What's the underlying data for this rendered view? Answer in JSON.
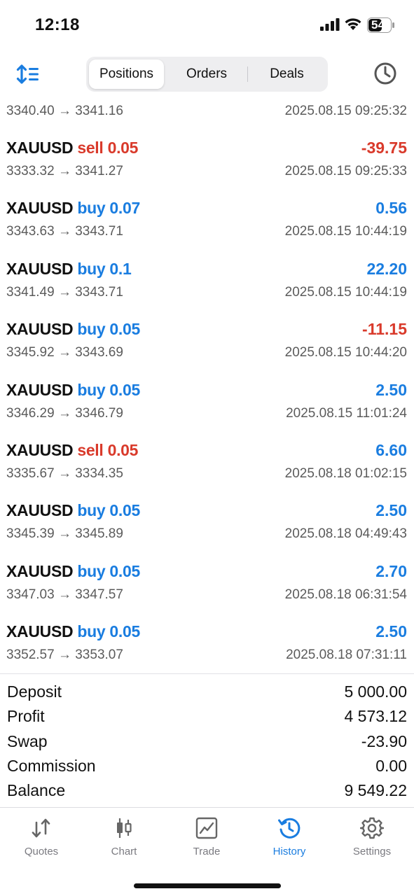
{
  "status_bar": {
    "time": "12:18",
    "battery": "54"
  },
  "toolbar": {
    "tabs": [
      {
        "label": "Positions",
        "active": true
      },
      {
        "label": "Orders",
        "active": false
      },
      {
        "label": "Deals",
        "active": false
      }
    ],
    "left_icon": "sort-icon",
    "right_icon": "clock-icon"
  },
  "colors": {
    "buy": "#1a7de0",
    "sell": "#d93a2b",
    "accent": "#1a7de0"
  },
  "partial_row": {
    "prices": "3340.40 → 3341.16",
    "date": "2025.08.15 09:25:32"
  },
  "trades": [
    {
      "symbol": "XAUUSD",
      "direction": "sell 0.05",
      "type": "sell",
      "profit": "-39.75",
      "profit_sign": "neg",
      "prices": "3333.32 → 3341.27",
      "date": "2025.08.15 09:25:33"
    },
    {
      "symbol": "XAUUSD",
      "direction": "buy 0.07",
      "type": "buy",
      "profit": "0.56",
      "profit_sign": "pos",
      "prices": "3343.63 → 3343.71",
      "date": "2025.08.15 10:44:19"
    },
    {
      "symbol": "XAUUSD",
      "direction": "buy 0.1",
      "type": "buy",
      "profit": "22.20",
      "profit_sign": "pos",
      "prices": "3341.49 → 3343.71",
      "date": "2025.08.15 10:44:19"
    },
    {
      "symbol": "XAUUSD",
      "direction": "buy 0.05",
      "type": "buy",
      "profit": "-11.15",
      "profit_sign": "neg",
      "prices": "3345.92 → 3343.69",
      "date": "2025.08.15 10:44:20"
    },
    {
      "symbol": "XAUUSD",
      "direction": "buy 0.05",
      "type": "buy",
      "profit": "2.50",
      "profit_sign": "pos",
      "prices": "3346.29 → 3346.79",
      "date": "2025.08.15 11:01:24"
    },
    {
      "symbol": "XAUUSD",
      "direction": "sell 0.05",
      "type": "sell",
      "profit": "6.60",
      "profit_sign": "pos",
      "prices": "3335.67 → 3334.35",
      "date": "2025.08.18 01:02:15"
    },
    {
      "symbol": "XAUUSD",
      "direction": "buy 0.05",
      "type": "buy",
      "profit": "2.50",
      "profit_sign": "pos",
      "prices": "3345.39 → 3345.89",
      "date": "2025.08.18 04:49:43"
    },
    {
      "symbol": "XAUUSD",
      "direction": "buy 0.05",
      "type": "buy",
      "profit": "2.70",
      "profit_sign": "pos",
      "prices": "3347.03 → 3347.57",
      "date": "2025.08.18 06:31:54"
    },
    {
      "symbol": "XAUUSD",
      "direction": "buy 0.05",
      "type": "buy",
      "profit": "2.50",
      "profit_sign": "pos",
      "prices": "3352.57 → 3353.07",
      "date": "2025.08.18 07:31:11"
    }
  ],
  "summary": [
    {
      "label": "Deposit",
      "value": "5 000.00"
    },
    {
      "label": "Profit",
      "value": "4 573.12"
    },
    {
      "label": "Swap",
      "value": "-23.90"
    },
    {
      "label": "Commission",
      "value": "0.00"
    },
    {
      "label": "Balance",
      "value": "9 549.22"
    }
  ],
  "bottom_tabs": [
    {
      "label": "Quotes",
      "icon": "quotes-icon",
      "active": false
    },
    {
      "label": "Chart",
      "icon": "candlestick-icon",
      "active": false
    },
    {
      "label": "Trade",
      "icon": "trade-chart-icon",
      "active": false
    },
    {
      "label": "History",
      "icon": "history-icon",
      "active": true
    },
    {
      "label": "Settings",
      "icon": "gear-icon",
      "active": false
    }
  ]
}
